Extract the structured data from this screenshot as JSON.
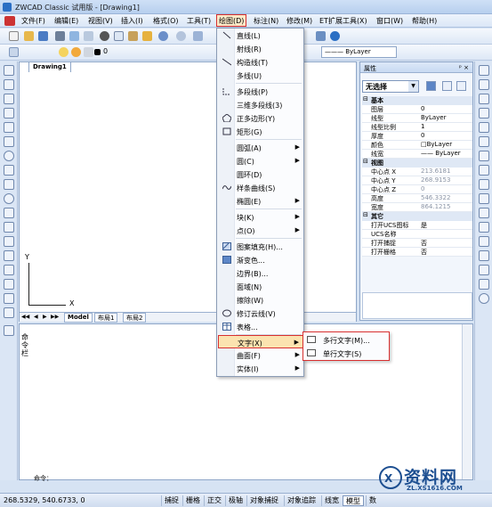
{
  "window": {
    "title": "ZWCAD Classic 试用版 - [Drawing1]"
  },
  "menubar": {
    "items": [
      "文件(F)",
      "编辑(E)",
      "视图(V)",
      "插入(I)",
      "格式(O)",
      "工具(T)",
      "绘图(D)",
      "标注(N)",
      "修改(M)",
      "ET扩展工具(X)",
      "窗口(W)",
      "帮助(H)"
    ],
    "active": "绘图(D)"
  },
  "toolbar2": {
    "layer_value": "0",
    "linetype": "ByLayer",
    "lineweight": "ByLayer"
  },
  "document": {
    "tab": "Drawing1",
    "axis_x": "X",
    "axis_y": "Y",
    "sheets": [
      "Model",
      "布局1",
      "布局2"
    ]
  },
  "properties": {
    "title": "属性",
    "pin": "ᵖ ×",
    "selection": "无选择",
    "categories": [
      {
        "name": "基本",
        "rows": [
          {
            "k": "图层",
            "v": "0"
          },
          {
            "k": "线型",
            "v": "ByLayer"
          },
          {
            "k": "线型比例",
            "v": "1"
          },
          {
            "k": "厚度",
            "v": "0"
          },
          {
            "k": "颜色",
            "v": "□ByLayer"
          },
          {
            "k": "线宽",
            "v": "—— ByLayer"
          }
        ]
      },
      {
        "name": "视图",
        "rows": [
          {
            "k": "中心点 X",
            "v": "213.6181"
          },
          {
            "k": "中心点 Y",
            "v": "268.9153"
          },
          {
            "k": "中心点 Z",
            "v": "0"
          },
          {
            "k": "高度",
            "v": "546.3322"
          },
          {
            "k": "宽度",
            "v": "864.1215"
          }
        ]
      },
      {
        "name": "其它",
        "rows": [
          {
            "k": "打开UCS图标",
            "v": "是"
          },
          {
            "k": "UCS名称",
            "v": ""
          },
          {
            "k": "打开捕捉",
            "v": "否"
          },
          {
            "k": "打开栅格",
            "v": "否"
          }
        ]
      }
    ]
  },
  "command": {
    "side_label": "命令栏",
    "prompt": "命令："
  },
  "status": {
    "coords": "268.5329, 540.6733, 0",
    "buttons": [
      "捕捉",
      "栅格",
      "正交",
      "极轴",
      "对象捕捉",
      "对象追踪",
      "线宽",
      "模型",
      "数"
    ]
  },
  "draw_menu": {
    "items": [
      {
        "label": "直线(L)",
        "icon": "line-icon"
      },
      {
        "label": "射线(R)",
        "icon": ""
      },
      {
        "label": "构造线(T)",
        "icon": "construction-line-icon"
      },
      {
        "label": "多线(U)",
        "icon": ""
      },
      {
        "label": "多段线(P)",
        "icon": "polyline-icon"
      },
      {
        "label": "三维多段线(3)",
        "icon": ""
      },
      {
        "label": "正多边形(Y)",
        "icon": "polygon-icon"
      },
      {
        "label": "矩形(G)",
        "icon": "rectangle-icon"
      },
      {
        "label": "圆弧(A)",
        "icon": "",
        "sub": true
      },
      {
        "label": "圆(C)",
        "icon": "",
        "sub": true
      },
      {
        "label": "圆环(D)",
        "icon": ""
      },
      {
        "label": "样条曲线(S)",
        "icon": "spline-icon"
      },
      {
        "label": "椭圆(E)",
        "icon": "",
        "sub": true
      },
      {
        "label": "块(K)",
        "icon": "",
        "sub": true
      },
      {
        "label": "点(O)",
        "icon": "",
        "sub": true
      },
      {
        "label": "图案填充(H)...",
        "icon": "hatch-icon"
      },
      {
        "label": "渐变色...",
        "icon": "gradient-icon"
      },
      {
        "label": "边界(B)...",
        "icon": ""
      },
      {
        "label": "面域(N)",
        "icon": ""
      },
      {
        "label": "擦除(W)",
        "icon": ""
      },
      {
        "label": "修订云线(V)",
        "icon": "revcloud-icon"
      },
      {
        "label": "表格...",
        "icon": "table-icon"
      },
      {
        "label": "文字(X)",
        "icon": "",
        "sub": true,
        "highlighted": true
      },
      {
        "label": "曲面(F)",
        "icon": "",
        "sub": true
      },
      {
        "label": "实体(I)",
        "icon": "",
        "sub": true
      }
    ]
  },
  "text_submenu": {
    "items": [
      "多行文字(M)...",
      "单行文字(S)"
    ]
  },
  "watermark": {
    "brand": "资料网",
    "url": "ZL.XS1616.COM"
  },
  "colors": {
    "highlight_border": "#d83030",
    "highlight_fill": "#fbe3b0",
    "accent": "#2b6fc4"
  }
}
